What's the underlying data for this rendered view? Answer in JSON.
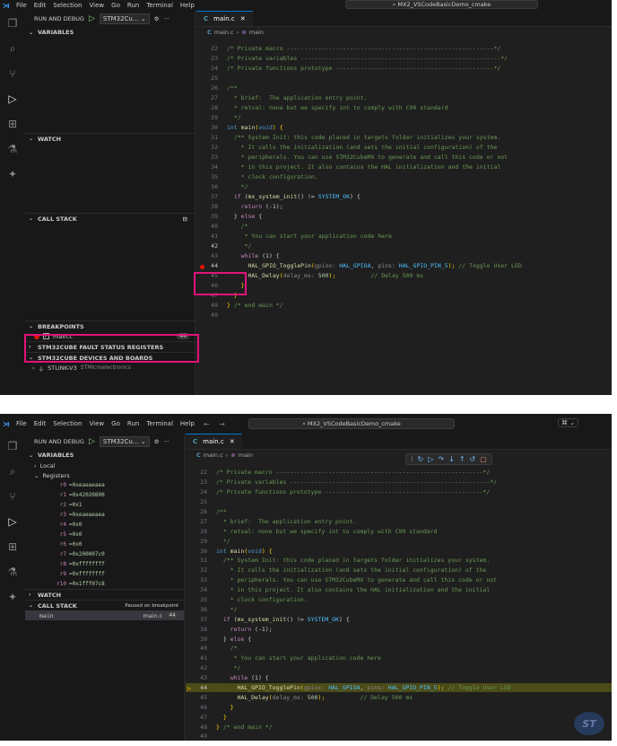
{
  "menu": [
    "File",
    "Edit",
    "Selection",
    "View",
    "Go",
    "Run",
    "Terminal",
    "Help"
  ],
  "search_text": "MX2_VSCodeBasicDemo_cmake",
  "run_and_debug_label": "RUN AND DEBUG",
  "debug_config": "STM32Cu...",
  "tab_label": "main.c",
  "breadcrumb": {
    "file": "main.c",
    "symbol": "main"
  },
  "shot1": {
    "sections": {
      "variables": "VARIABLES",
      "watch": "WATCH",
      "call_stack": "CALL STACK",
      "breakpoints": "BREAKPOINTS",
      "fault_regs": "STM32CUBE FAULT STATUS REGISTERS",
      "devices": "STM32CUBE DEVICES AND BOARDS"
    },
    "breakpoint": {
      "file": "main.c",
      "line": "44"
    },
    "device": {
      "name": "STLINK-V3",
      "vendor": "STMicroelectronics"
    }
  },
  "shot2": {
    "sections": {
      "variables": "VARIABLES",
      "local": "Local",
      "registers": "Registers",
      "watch": "WATCH",
      "call_stack": "CALL STACK",
      "paused": "Paused on breakpoint"
    },
    "registers": [
      {
        "name": "r0",
        "value": "0xeaeaeaea"
      },
      {
        "name": "r1",
        "value": "0x42020800"
      },
      {
        "name": "r2",
        "value": "0x1"
      },
      {
        "name": "r3",
        "value": "0xeaeaeaea"
      },
      {
        "name": "r4",
        "value": "0x0"
      },
      {
        "name": "r5",
        "value": "0x0"
      },
      {
        "name": "r6",
        "value": "0x0"
      },
      {
        "name": "r7",
        "value": "0x200007c0"
      },
      {
        "name": "r8",
        "value": "0xffffffff"
      },
      {
        "name": "r9",
        "value": "0xffffffff"
      },
      {
        "name": "r10",
        "value": "0x1fff07c8"
      }
    ],
    "stack_frame": {
      "fn": "main",
      "file": "main.c",
      "line": "44"
    }
  },
  "code": {
    "l22": "/* Private macro -----------------------------------------------------------*/",
    "l23": "/* Private variables ---------------------------------------------------------*/",
    "l24": "/* Private functions prototype ---------------------------------------------*/",
    "l26": "/**",
    "l27": "  * brief:  The application entry point.",
    "l28": "  * retval: none but we specify int to comply with C99 standard",
    "l29": "  */",
    "l30a": "int",
    "l30b": " main",
    "l30c": "(",
    "l30d": "void",
    "l30e": ") {",
    "l31": "/** System Init: this code placed in targets folder initializes your system.",
    "l32": "    * It calls the initialization (and sets the initial configuration) of the",
    "l33": "    * peripherals. You can use STM32CubeMX to generate and call this code or not",
    "l34": "    * in this project. It also contains the HAL initialization and the initial",
    "l35": "    * clock configuration.",
    "l36": "    */",
    "l37a": "if",
    "l37b": " (",
    "l37c": "mx_system_init",
    "l37d": "() != ",
    "l37e": "SYSTEM_OK",
    "l37f": ") {",
    "l38a": "return",
    "l38b": " (-1);",
    "l39a": "} ",
    "l39b": "else",
    "l39c": " {",
    "l40": "/*",
    "l41": "     * You can start your application code here",
    "l42": "     */",
    "l43a": "while",
    "l43b": " (1) {",
    "l44a": "HAL_GPIO_TogglePin",
    "l44b": "(",
    "l44c": "gpiox:",
    "l44d": " HAL_GPIOA",
    "l44e": ", ",
    "l44f": "pins:",
    "l44g": " HAL_GPIO_PIN_5",
    "l44h": ");",
    "l44i": " // Toggle User LED",
    "l45a": "HAL_Delay",
    "l45b": "(",
    "l45c": "delay_ms:",
    "l45d": " 500",
    "l45e": ");",
    "l45f": "          // Delay 500 ms",
    "l46": "}",
    "l47": "}",
    "l48a": "}",
    "l48b": " /* end main */"
  },
  "colors": {
    "accent": "#0078d4",
    "breakpoint": "#e51400",
    "highlight_box": "#e0137a",
    "current_line": "#4b4b18"
  }
}
